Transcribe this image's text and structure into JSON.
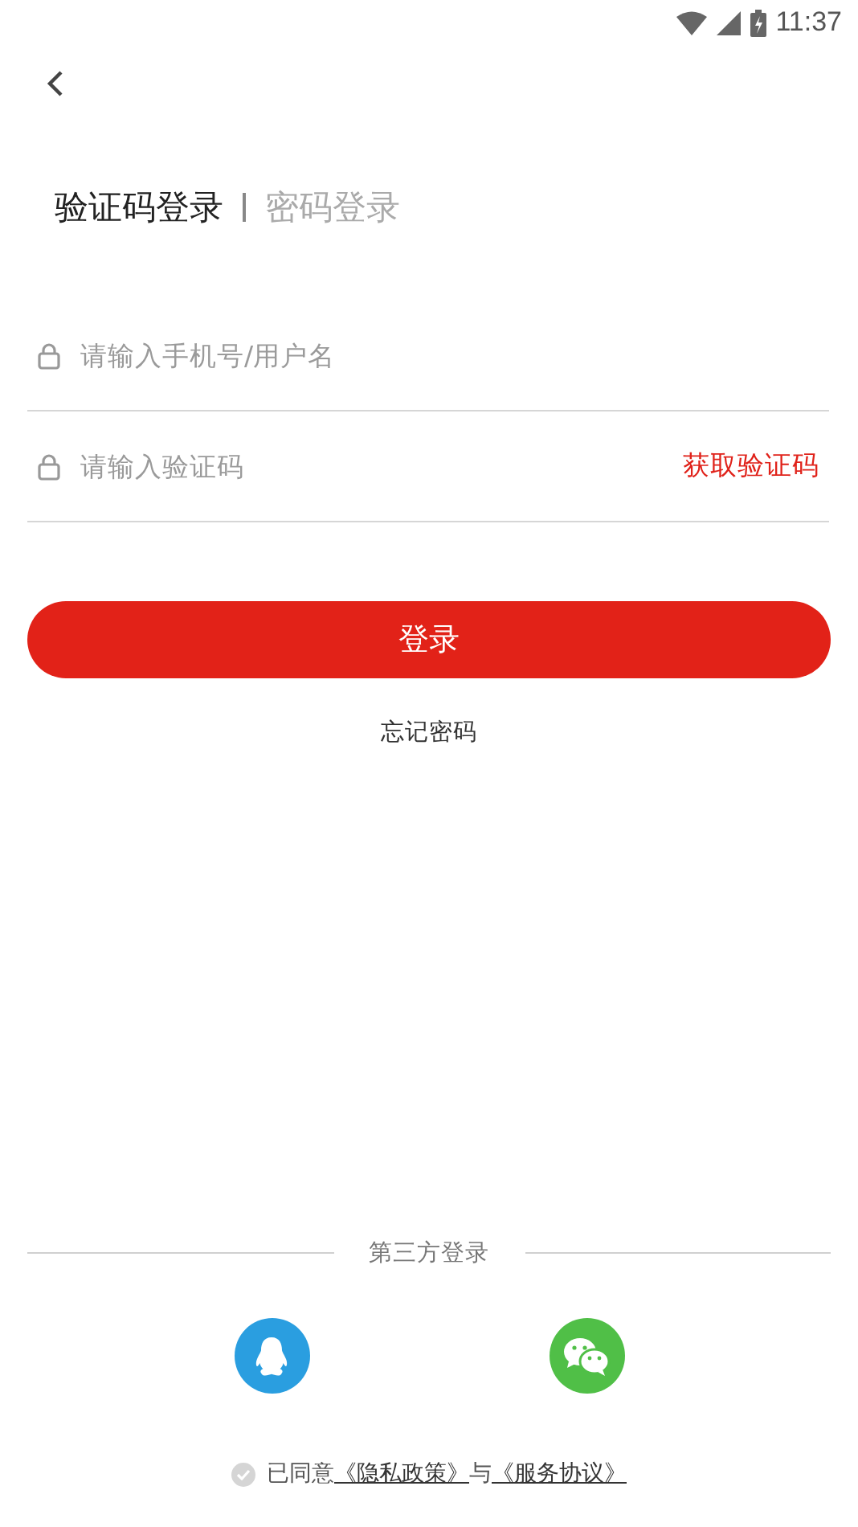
{
  "status_bar": {
    "time": "11:37"
  },
  "tabs": [
    {
      "label": "验证码登录",
      "selected": true
    },
    {
      "label": "密码登录",
      "selected": false
    }
  ],
  "fields": [
    {
      "placeholder": "请输入手机号/用户名"
    },
    {
      "placeholder": "请输入验证码",
      "action": "获取验证码"
    }
  ],
  "login_button": "登录",
  "forgot_link": "忘记密码",
  "third_party": {
    "title": "第三方登录",
    "providers": [
      {
        "kind": "qq",
        "color": "#2a9ee0"
      },
      {
        "kind": "wechat",
        "color": "#50bf47"
      }
    ]
  },
  "agreement": {
    "checked": false,
    "prefix": "已同意",
    "privacy_link": "《隐私政策》",
    "joiner": "与",
    "terms_link": "《服务协议》"
  }
}
